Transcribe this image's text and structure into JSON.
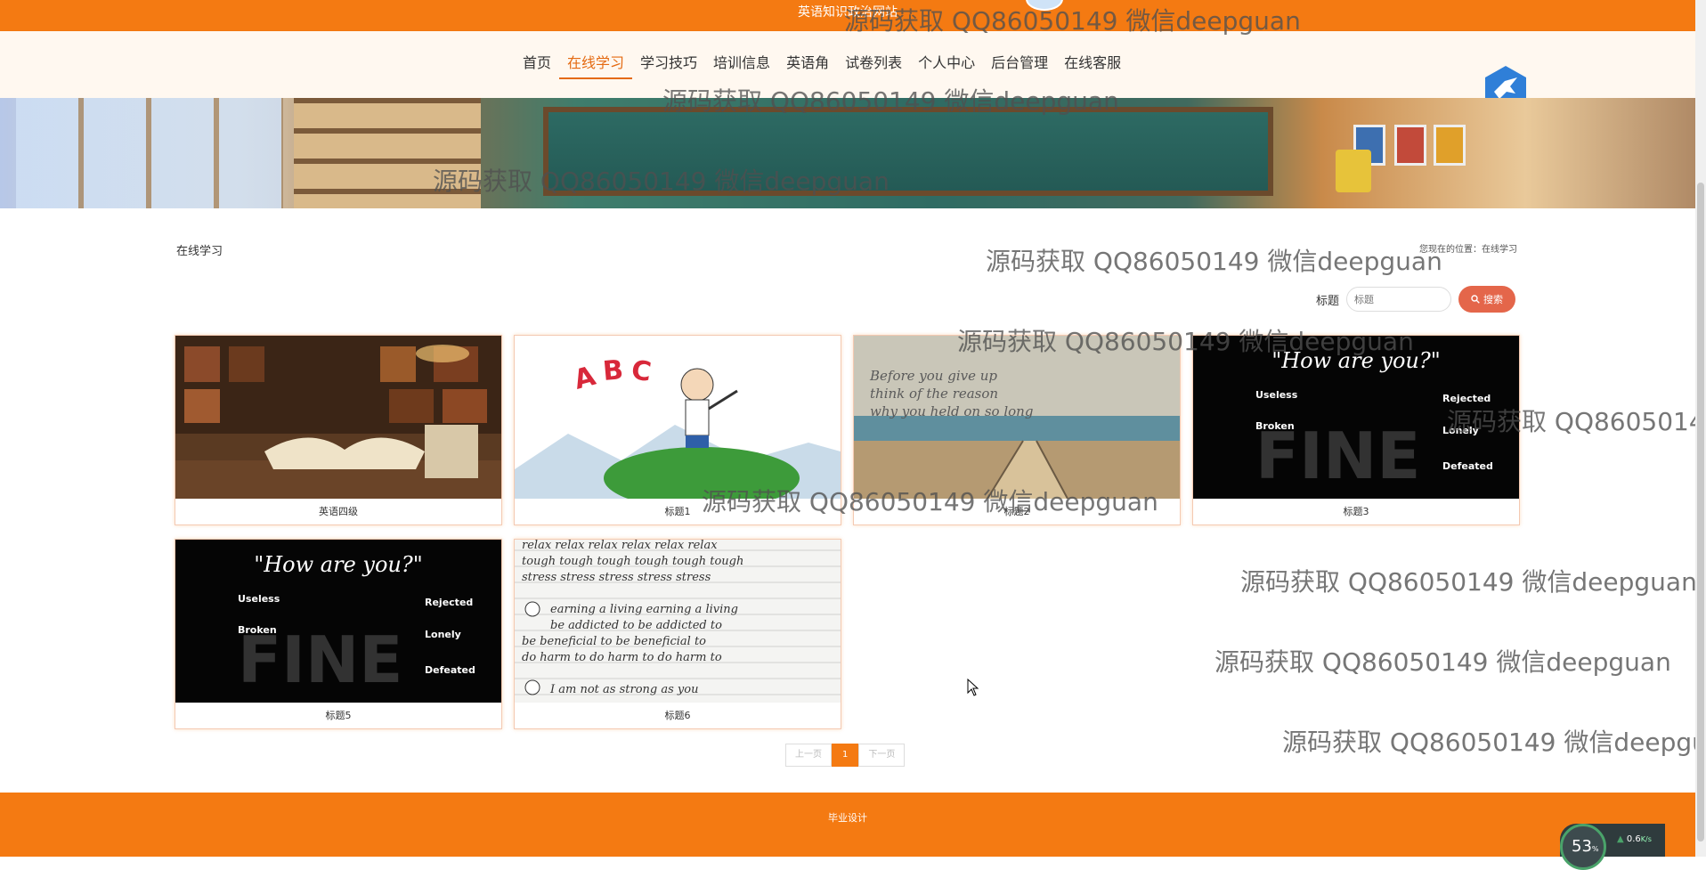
{
  "topbar": {
    "title": "英语知识政治网站"
  },
  "nav": {
    "items": [
      {
        "label": "首页"
      },
      {
        "label": "在线学习"
      },
      {
        "label": "学习技巧"
      },
      {
        "label": "培训信息"
      },
      {
        "label": "英语角"
      },
      {
        "label": "试卷列表"
      },
      {
        "label": "个人中心"
      },
      {
        "label": "后台管理"
      },
      {
        "label": "在线客服"
      }
    ],
    "active_index": 1
  },
  "page": {
    "section_title": "在线学习",
    "breadcrumb": "您现在的位置：在线学习"
  },
  "search": {
    "label": "标题",
    "placeholder": "标题",
    "button_label": "搜索"
  },
  "cards": [
    {
      "caption": "英语四级",
      "image": "library-books"
    },
    {
      "caption": "标题1",
      "image": "abc-cartoon"
    },
    {
      "caption": "标题2",
      "image": "beach-quote"
    },
    {
      "caption": "标题3",
      "image": "how-are-you-fine"
    },
    {
      "caption": "标题5",
      "image": "how-are-you-fine"
    },
    {
      "caption": "标题6",
      "image": "handwriting-sheet"
    }
  ],
  "pagination": {
    "prev_label": "上一页",
    "current": "1",
    "next_label": "下一页"
  },
  "footer": {
    "text": "毕业设计"
  },
  "watermark": {
    "text": "源码获取 QQ86050149 微信deepguan"
  },
  "widget": {
    "percent": "53",
    "percent_unit": "%",
    "speed": "0.6",
    "speed_unit": "K/s"
  },
  "colors": {
    "brand": "#f47a12",
    "accent": "#e46a12",
    "search_button": "#e4664a"
  }
}
